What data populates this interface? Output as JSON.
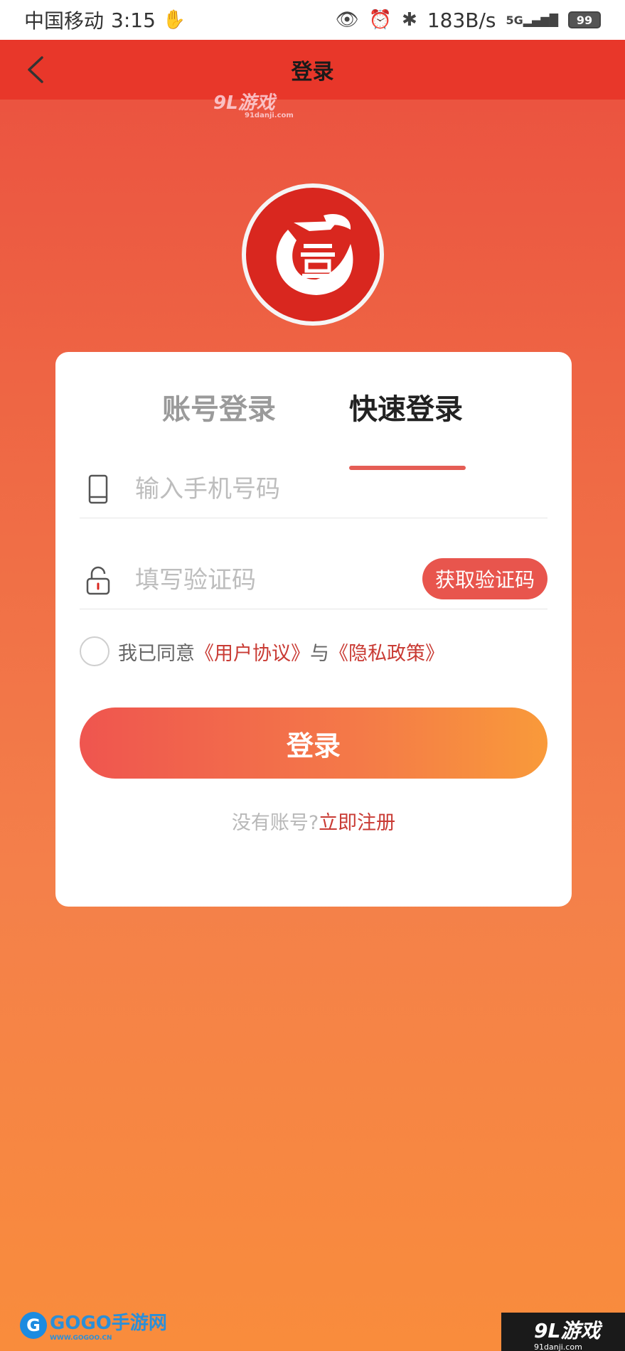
{
  "status_bar": {
    "carrier": "中国移动",
    "time": "3:15",
    "speed": "183B/s",
    "signal": "5G",
    "battery": "99"
  },
  "nav": {
    "title": "登录"
  },
  "watermark_top": {
    "brand": "9L游戏",
    "url": "91danji.com"
  },
  "login": {
    "tabs": [
      {
        "label": "账号登录",
        "active": false
      },
      {
        "label": "快速登录",
        "active": true
      }
    ],
    "phone_placeholder": "输入手机号码",
    "code_placeholder": "填写验证码",
    "get_code_label": "获取验证码",
    "agree_prefix": "我已同意",
    "user_agreement": "《用户协议》",
    "agree_and": "与",
    "privacy_policy": "《隐私政策》",
    "submit_label": "登录",
    "no_account": "没有账号?",
    "register_link": "立即注册"
  },
  "watermarks_bottom": {
    "left_brand": "GOGO手游网",
    "left_url": "WWW.GOGOO.CN",
    "right_brand": "9L游戏",
    "right_url": "91danji.com"
  },
  "colors": {
    "nav_bg": "#e8372a",
    "accent": "#e8554d",
    "link": "#c93b34",
    "gradient_top": "#ea4e3f",
    "gradient_bottom": "#f98c3c"
  }
}
